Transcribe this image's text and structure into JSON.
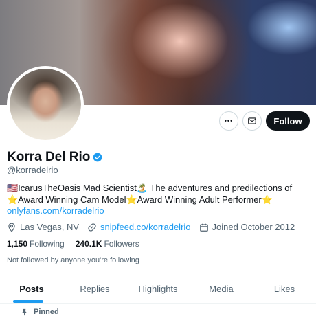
{
  "profile": {
    "display_name": "Korra Del Rio",
    "handle": "@korradelrio",
    "bio": "🇺🇸IcarusTheOasis Mad Scientist🏝️ The adventures and predilections of ⭐Award Winning Cam Model⭐Award Winning Adult Performer⭐",
    "bio_link": "onlyfans.com/korradelrio",
    "location": "Las Vegas, NV",
    "website": "snipfeed.co/korradelrio",
    "joined": "Joined October 2012",
    "following_count": "1,150",
    "following_label": "Following",
    "followers_count": "240.1K",
    "followers_label": "Followers",
    "not_followed_text": "Not followed by anyone you're following"
  },
  "actions": {
    "more_label": "•••",
    "follow_label": "Follow"
  },
  "tabs": [
    {
      "label": "Posts",
      "active": true
    },
    {
      "label": "Replies",
      "active": false
    },
    {
      "label": "Highlights",
      "active": false
    },
    {
      "label": "Media",
      "active": false
    },
    {
      "label": "Likes",
      "active": false
    }
  ],
  "pinned_label": "Pinned",
  "colors": {
    "accent": "#1d9bf0",
    "text_primary": "#0f1419",
    "text_secondary": "#536471",
    "follow_button_bg": "#0f1419"
  },
  "icons": {
    "verified": "verified-badge-icon",
    "more": "more-icon",
    "message": "mail-icon",
    "location": "location-pin-icon",
    "link": "link-icon",
    "calendar": "calendar-icon",
    "pin": "pin-icon"
  }
}
